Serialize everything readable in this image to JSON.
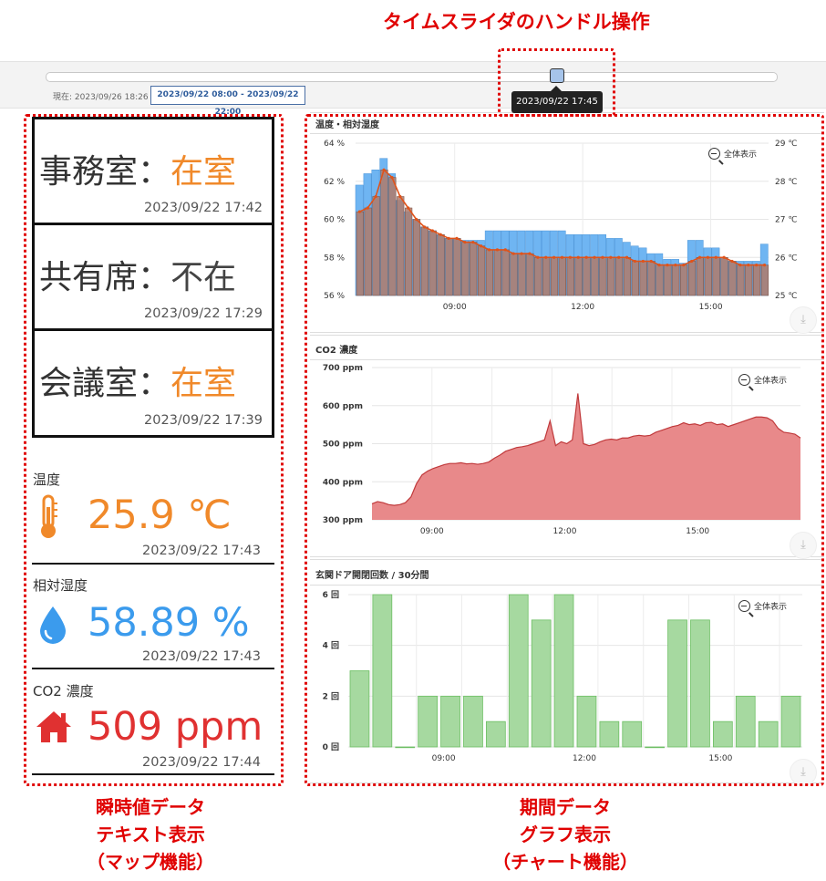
{
  "callouts": {
    "top": "タイムスライダのハンドル操作",
    "left": [
      "瞬時値データ",
      "テキスト表示",
      "（マップ機能）"
    ],
    "right": [
      "期間データ",
      "グラフ表示",
      "（チャート機能）"
    ]
  },
  "time_slider": {
    "now_label": "現在: 2023/09/26 18:26",
    "range": "2023/09/22 08:00 - 2023/09/22 22:00",
    "handle_tooltip": "2023/09/22 17:45",
    "handle_position": 0.7
  },
  "rooms": [
    {
      "name": "事務室",
      "separator": "：",
      "status": "在室",
      "state": "present",
      "time": "2023/09/22 17:42"
    },
    {
      "name": "共有席",
      "separator": "：",
      "status": "不在",
      "state": "absent",
      "time": "2023/09/22 17:29"
    },
    {
      "name": "会議室",
      "separator": "：",
      "status": "在室",
      "state": "present",
      "time": "2023/09/22 17:39"
    }
  ],
  "sensors": [
    {
      "label": "温度",
      "icon": "thermometer-icon",
      "value": "25.9 ℃",
      "color": "#f0892a",
      "time": "2023/09/22 17:43"
    },
    {
      "label": "相対湿度",
      "icon": "water-drop-icon",
      "value": "58.89 %",
      "color": "#3b9bed",
      "time": "2023/09/22 17:43"
    },
    {
      "label": "CO2 濃度",
      "icon": "home-icon",
      "value": "509 ppm",
      "color": "#e03131",
      "time": "2023/09/22 17:44"
    }
  ],
  "zoom_label": "全体表示",
  "colors": {
    "humidity_bar": "#6fb5f2",
    "temperature_bar": "#b07a6a",
    "temperature_line": "#e0531a",
    "co2_fill": "#e8898a",
    "door_bar": "#a6d9a0",
    "accent_red": "#e00000"
  },
  "chart_data": [
    {
      "type": "bar",
      "title": "温度・相対湿度",
      "x_ticks": [
        "09:00",
        "12:00",
        "15:00"
      ],
      "y_left_ticks": [
        "56 %",
        "58 %",
        "60 %",
        "62 %",
        "64 %"
      ],
      "y_right_ticks": [
        "25 ℃",
        "26 ℃",
        "27 ℃",
        "28 ℃",
        "29 ℃"
      ],
      "y_left_range": [
        56,
        64
      ],
      "y_right_range": [
        25,
        29
      ],
      "series": [
        {
          "name": "相対湿度",
          "unit": "%",
          "type": "bar",
          "axis": "left",
          "values": [
            61.8,
            62.4,
            62.6,
            63.2,
            62.4,
            61.0,
            60.4,
            60.0,
            59.6,
            59.4,
            59.2,
            59.0,
            59.0,
            58.9,
            58.9,
            58.9,
            59.4,
            59.4,
            59.4,
            59.4,
            59.4,
            59.4,
            59.4,
            59.4,
            59.4,
            59.4,
            59.2,
            59.2,
            59.2,
            59.2,
            59.2,
            59.0,
            59.0,
            58.8,
            58.6,
            58.5,
            58.2,
            58.2,
            57.9,
            57.9,
            57.7,
            58.9,
            58.9,
            58.5,
            58.5,
            58.0,
            57.8,
            57.8,
            57.8,
            57.8,
            58.7
          ]
        },
        {
          "name": "温度",
          "unit": "℃",
          "type": "bar+line",
          "axis": "right",
          "values": [
            27.2,
            27.3,
            27.6,
            28.3,
            28.1,
            27.6,
            27.3,
            27.0,
            26.8,
            26.7,
            26.6,
            26.5,
            26.5,
            26.4,
            26.4,
            26.3,
            26.2,
            26.2,
            26.2,
            26.1,
            26.1,
            26.1,
            26.0,
            26.0,
            26.0,
            26.0,
            26.0,
            26.0,
            26.0,
            26.0,
            26.0,
            26.0,
            26.0,
            26.0,
            25.9,
            25.9,
            25.9,
            25.8,
            25.8,
            25.8,
            25.8,
            25.9,
            26.0,
            26.0,
            26.0,
            26.0,
            25.9,
            25.8,
            25.8,
            25.8,
            25.8
          ]
        }
      ]
    },
    {
      "type": "area",
      "title": "CO2 濃度",
      "x_ticks": [
        "09:00",
        "12:00",
        "15:00"
      ],
      "y_ticks": [
        "300 ppm",
        "400 ppm",
        "500 ppm",
        "600 ppm",
        "700 ppm"
      ],
      "ylim": [
        300,
        700
      ],
      "series": [
        {
          "name": "CO2 濃度",
          "unit": "ppm",
          "values": [
            342,
            348,
            345,
            340,
            338,
            340,
            345,
            360,
            395,
            418,
            428,
            435,
            440,
            445,
            448,
            448,
            450,
            447,
            448,
            446,
            448,
            452,
            462,
            470,
            480,
            485,
            490,
            492,
            495,
            500,
            505,
            510,
            560,
            495,
            505,
            500,
            510,
            632,
            500,
            495,
            498,
            505,
            510,
            512,
            510,
            515,
            515,
            520,
            522,
            520,
            522,
            530,
            535,
            540,
            545,
            548,
            555,
            550,
            552,
            548,
            555,
            556,
            550,
            552,
            545,
            550,
            555,
            560,
            565,
            570,
            570,
            568,
            560,
            540,
            530,
            528,
            525,
            515
          ]
        }
      ]
    },
    {
      "type": "bar",
      "title": "玄関ドア開閉回数 / 30分間",
      "x_ticks": [
        "09:00",
        "12:00",
        "15:00"
      ],
      "y_ticks": [
        "0 回",
        "2 回",
        "4 回",
        "6 回"
      ],
      "ylim": [
        0,
        6
      ],
      "series": [
        {
          "name": "玄関ドア開閉回数",
          "unit": "回",
          "values": [
            3,
            6,
            0,
            2,
            2,
            2,
            1,
            6,
            5,
            6,
            2,
            1,
            1,
            0,
            5,
            5,
            1,
            2,
            1,
            2
          ]
        }
      ]
    }
  ]
}
